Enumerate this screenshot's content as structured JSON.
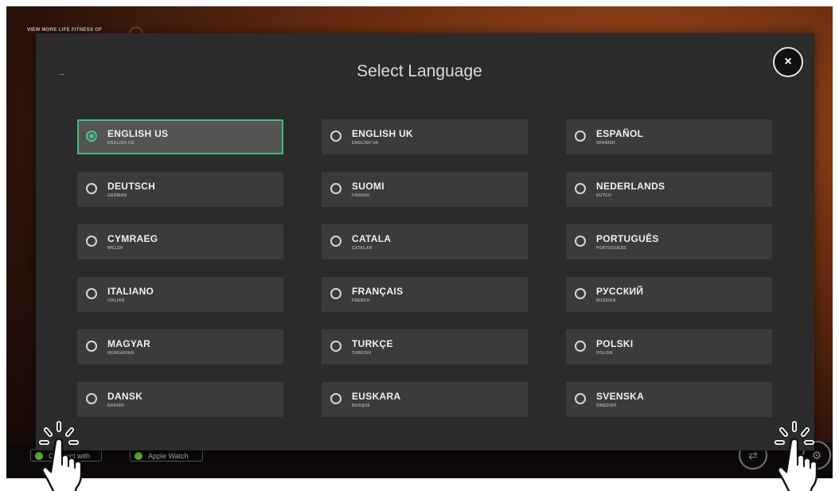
{
  "background": {
    "link_text": "VIEW MORE LIFE FITNESS OF",
    "pills": [
      {
        "label": "Connect with"
      },
      {
        "label": "Apple Watch"
      }
    ]
  },
  "modal": {
    "title": "Select Language",
    "close_label": "×"
  },
  "languages": [
    {
      "name": "ENGLISH US",
      "sub": "ENGLISH US",
      "selected": true
    },
    {
      "name": "ENGLISH UK",
      "sub": "ENGLISH UK",
      "selected": false
    },
    {
      "name": "ESPAÑOL",
      "sub": "SPANISH",
      "selected": false
    },
    {
      "name": "DEUTSCH",
      "sub": "GERMAN",
      "selected": false
    },
    {
      "name": "SUOMI",
      "sub": "FINNISH",
      "selected": false
    },
    {
      "name": "NEDERLANDS",
      "sub": "DUTCH",
      "selected": false
    },
    {
      "name": "CYMRAEG",
      "sub": "WELSH",
      "selected": false
    },
    {
      "name": "CATALA",
      "sub": "CATALAN",
      "selected": false
    },
    {
      "name": "PORTUGUÊS",
      "sub": "PORTUGUESE",
      "selected": false
    },
    {
      "name": "ITALIANO",
      "sub": "ITALIAN",
      "selected": false
    },
    {
      "name": "FRANÇAIS",
      "sub": "FRENCH",
      "selected": false
    },
    {
      "name": "РУССКИЙ",
      "sub": "RUSSIAN",
      "selected": false
    },
    {
      "name": "MAGYAR",
      "sub": "HUNGARIAN",
      "selected": false
    },
    {
      "name": "TURKÇE",
      "sub": "TURKISH",
      "selected": false
    },
    {
      "name": "POLSKI",
      "sub": "POLISH",
      "selected": false
    },
    {
      "name": "DANSK",
      "sub": "DANISH",
      "selected": false
    },
    {
      "name": "EUSKARA",
      "sub": "BASQUE",
      "selected": false
    },
    {
      "name": "SVENSKA",
      "sub": "SWEDISH",
      "selected": false
    }
  ],
  "colors": {
    "accent": "#48c989",
    "modal_bg": "#2b2b2b",
    "item_bg": "#3b3b3b"
  },
  "icons": [
    "close-icon",
    "radio-icon",
    "tap-hand-icon",
    "share-icon",
    "settings-icon"
  ]
}
